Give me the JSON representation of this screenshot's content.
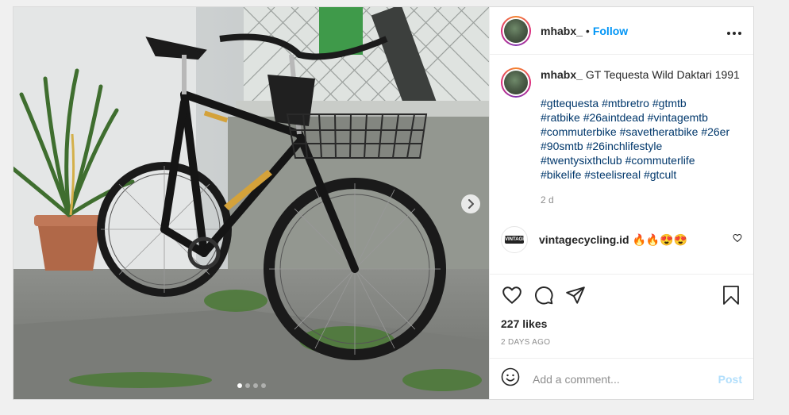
{
  "post": {
    "username": "mhabx_",
    "separator": "•",
    "follow_label": "Follow",
    "more_icon": "more-horizontal-icon",
    "caption_title": "GT Tequesta Wild Daktari 1991",
    "hashtags": [
      "#gttequesta",
      "#mtbretro",
      "#gtmtb",
      "#ratbike",
      "#26aintdead",
      "#vintagemtb",
      "#commuterbike",
      "#savetheratbike",
      "#26er",
      "#90smtb",
      "#26inchlifestyle",
      "#twentysixthclub",
      "#commuterlife",
      "#bikelife",
      "#steelisreal",
      "#gtcult"
    ],
    "time_ago": "2 d",
    "likes": "227 likes",
    "date": "2 DAYS AGO"
  },
  "comment": {
    "username": "vintagecycling.id",
    "text": "🔥🔥😍😍",
    "avatar_label": "VINTAGE"
  },
  "add_comment": {
    "placeholder": "Add a comment...",
    "post_label": "Post"
  },
  "carousel": {
    "dot_count": 4,
    "active_dot": 0
  },
  "colors": {
    "link": "#0095f6",
    "hashtag": "#00376b",
    "muted": "#8e8e8e",
    "post_disabled": "#b2dffc"
  }
}
